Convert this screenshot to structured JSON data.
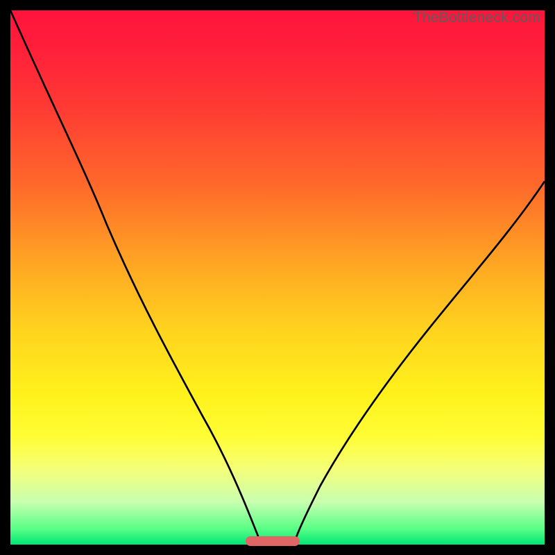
{
  "watermark": "TheBottleneck.com",
  "colors": {
    "frame": "#000000",
    "curve": "#000000",
    "bar": "#e06666"
  },
  "chart_data": {
    "type": "line",
    "title": "",
    "xlabel": "",
    "ylabel": "",
    "xlim": [
      0,
      100
    ],
    "ylim": [
      0,
      100
    ],
    "grid": false,
    "series": [
      {
        "name": "left-branch",
        "x": [
          0,
          6,
          12,
          18,
          24,
          30,
          36,
          42,
          45,
          47
        ],
        "y": [
          100,
          87,
          74,
          60,
          47,
          35,
          24,
          13,
          5,
          0
        ]
      },
      {
        "name": "right-branch",
        "x": [
          53,
          56,
          62,
          70,
          80,
          90,
          100
        ],
        "y": [
          0,
          5,
          14,
          26,
          41,
          55,
          68
        ]
      }
    ],
    "annotations": [
      {
        "type": "bar",
        "x_start": 44,
        "x_end": 54,
        "y": 0.5,
        "color": "#e06666"
      }
    ]
  }
}
